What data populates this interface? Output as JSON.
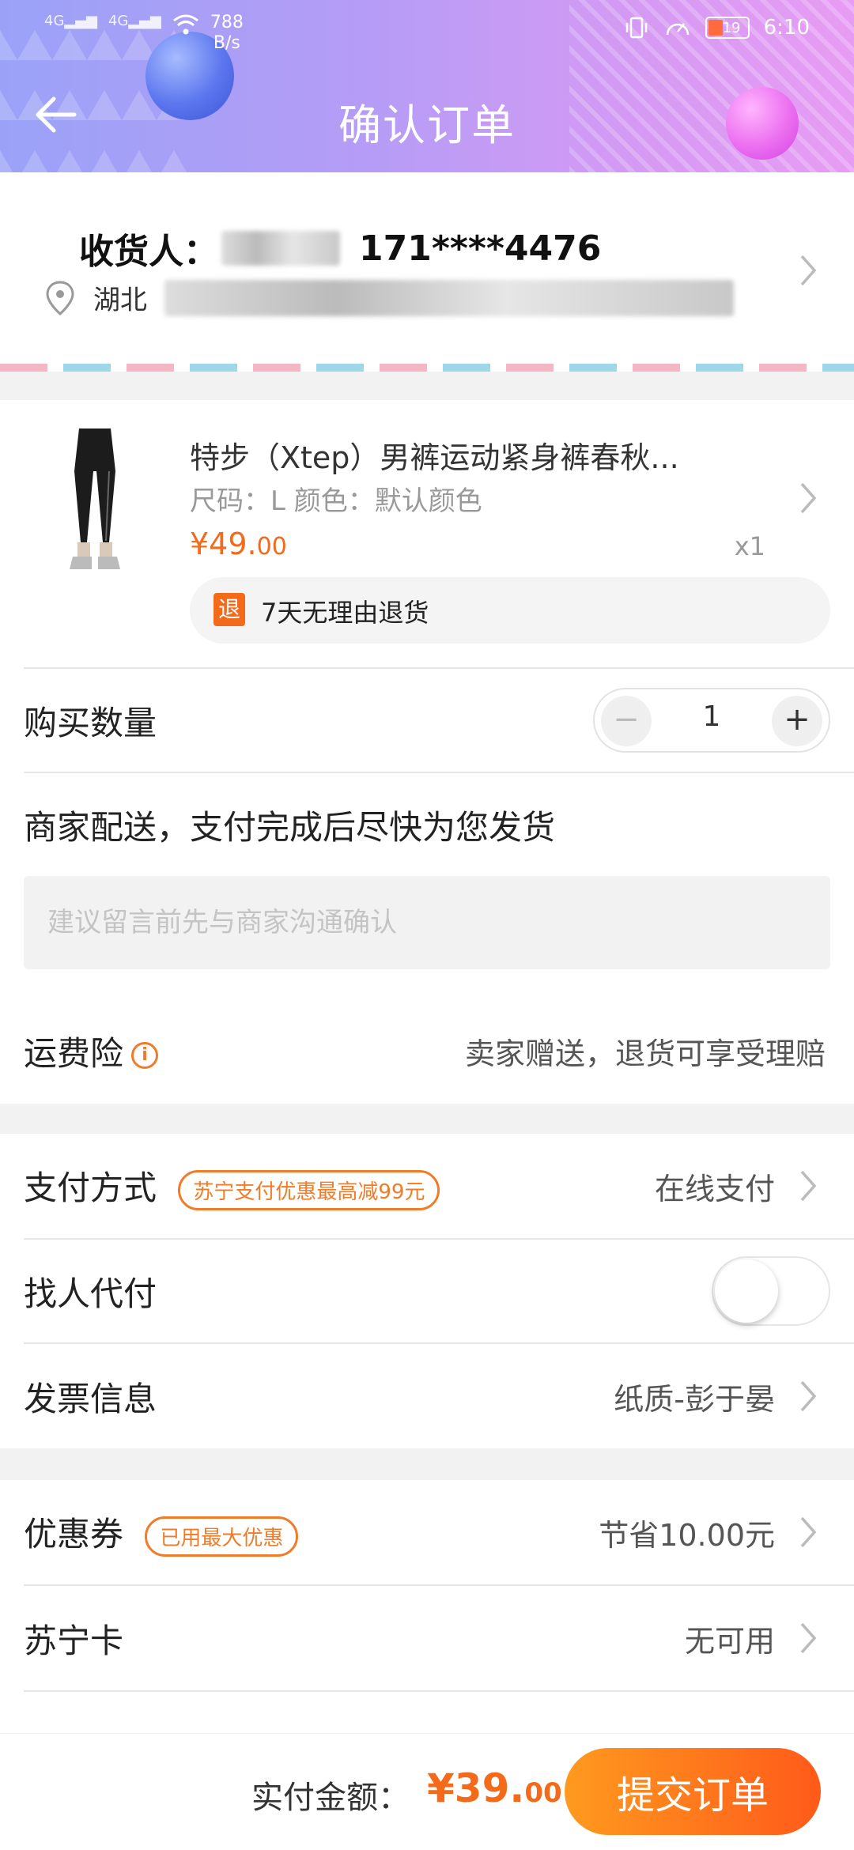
{
  "status_bar": {
    "signal_1": "4G",
    "signal_2": "4G",
    "net_speed_value": "788",
    "net_speed_unit": "B/s",
    "battery": "19",
    "time": "6:10"
  },
  "header": {
    "title": "确认订单"
  },
  "address": {
    "receiver_label": "收货人：",
    "phone": "171****4476",
    "address_prefix": "湖北"
  },
  "product": {
    "title": "特步（Xtep）男裤运动紧身裤春秋...",
    "spec": "尺码：L  颜色：默认颜色",
    "price_main": "¥49.",
    "price_decimal": "00",
    "quantity": "x1",
    "refund_icon": "退",
    "refund_text": "7天无理由退货"
  },
  "quantity_row": {
    "label": "购买数量",
    "minus": "−",
    "value": "1",
    "plus": "+"
  },
  "delivery": {
    "text": "商家配送，支付完成后尽快为您发货"
  },
  "message": {
    "placeholder": "建议留言前先与商家沟通确认",
    "value": ""
  },
  "insurance": {
    "label": "运费险",
    "info_icon": "i",
    "value": "卖家赠送，退货可享受理赔"
  },
  "payment": {
    "label": "支付方式",
    "promo_tag": "苏宁支付优惠最高减99元",
    "value": "在线支付"
  },
  "proxy_pay": {
    "label": "找人代付",
    "enabled": false
  },
  "invoice": {
    "label": "发票信息",
    "value": "纸质-彭于晏"
  },
  "coupon": {
    "label": "优惠券",
    "tag": "已用最大优惠",
    "value": "节省10.00元"
  },
  "suning_card": {
    "label": "苏宁卡",
    "value": "无可用"
  },
  "footer": {
    "total_label": "实付金额：",
    "total_main": "¥39.",
    "total_decimal": "00",
    "submit_label": "提交订单"
  },
  "colors": {
    "accent": "#f36a1a",
    "header_start": "#9aa2f7",
    "header_end": "#e79cf3"
  }
}
